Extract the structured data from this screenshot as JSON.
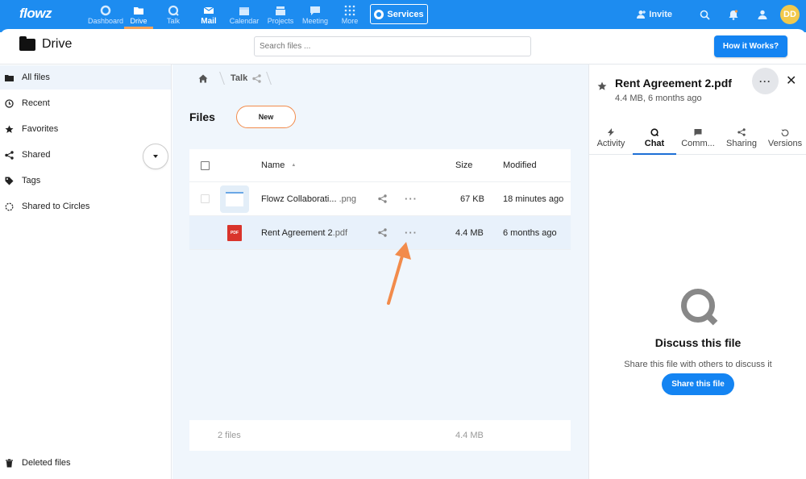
{
  "topnav": {
    "logo": "flowz",
    "items": [
      {
        "label": "Dashboard",
        "icon": "dashboard-icon"
      },
      {
        "label": "Drive",
        "icon": "folder-icon"
      },
      {
        "label": "Talk",
        "icon": "talk-icon"
      },
      {
        "label": "Mail",
        "icon": "mail-icon"
      },
      {
        "label": "Calendar",
        "icon": "calendar-icon"
      },
      {
        "label": "Projects",
        "icon": "projects-icon"
      },
      {
        "label": "Meeting",
        "icon": "meeting-icon"
      },
      {
        "label": "More",
        "icon": "grid-icon"
      }
    ],
    "services_label": "Services",
    "invite_label": "Invite",
    "avatar_initials": "DD",
    "accent_color": "#1d8cf0"
  },
  "header": {
    "title": "Drive",
    "search_placeholder": "Search files ...",
    "how_button": "How it Works?"
  },
  "sidebar": {
    "items": [
      {
        "label": "All files",
        "icon": "folder-icon"
      },
      {
        "label": "Recent",
        "icon": "clock-icon"
      },
      {
        "label": "Favorites",
        "icon": "star-icon"
      },
      {
        "label": "Shared",
        "icon": "share-icon"
      },
      {
        "label": "Tags",
        "icon": "tag-icon"
      },
      {
        "label": "Shared to Circles",
        "icon": "circles-icon"
      }
    ],
    "deleted_label": "Deleted files"
  },
  "main": {
    "breadcrumb_current": "Talk",
    "files_title": "Files",
    "new_button": "New",
    "columns": {
      "name": "Name",
      "size": "Size",
      "modified": "Modified"
    },
    "rows": [
      {
        "name": "Flowz Collaborati...",
        "ext": ".png",
        "size": "67 KB",
        "modified": "18 minutes ago"
      },
      {
        "name": "Rent Agreement 2",
        "ext": ".pdf",
        "size": "4.4 MB",
        "modified": "6 months ago"
      }
    ],
    "footer": {
      "count": "2 files",
      "total_size": "4.4 MB"
    },
    "pdf_badge": "PDF"
  },
  "panel": {
    "title": "Rent Agreement 2.pdf",
    "subtitle": "4.4 MB, 6 months ago",
    "tabs": [
      {
        "label": "Activity",
        "icon": "bolt-icon"
      },
      {
        "label": "Chat",
        "icon": "chat-icon"
      },
      {
        "label": "Comm...",
        "icon": "comment-icon"
      },
      {
        "label": "Sharing",
        "icon": "share-icon"
      },
      {
        "label": "Versions",
        "icon": "history-icon"
      }
    ],
    "discuss_title": "Discuss this file",
    "discuss_sub": "Share this file with others to discuss it",
    "share_button": "Share this file"
  }
}
